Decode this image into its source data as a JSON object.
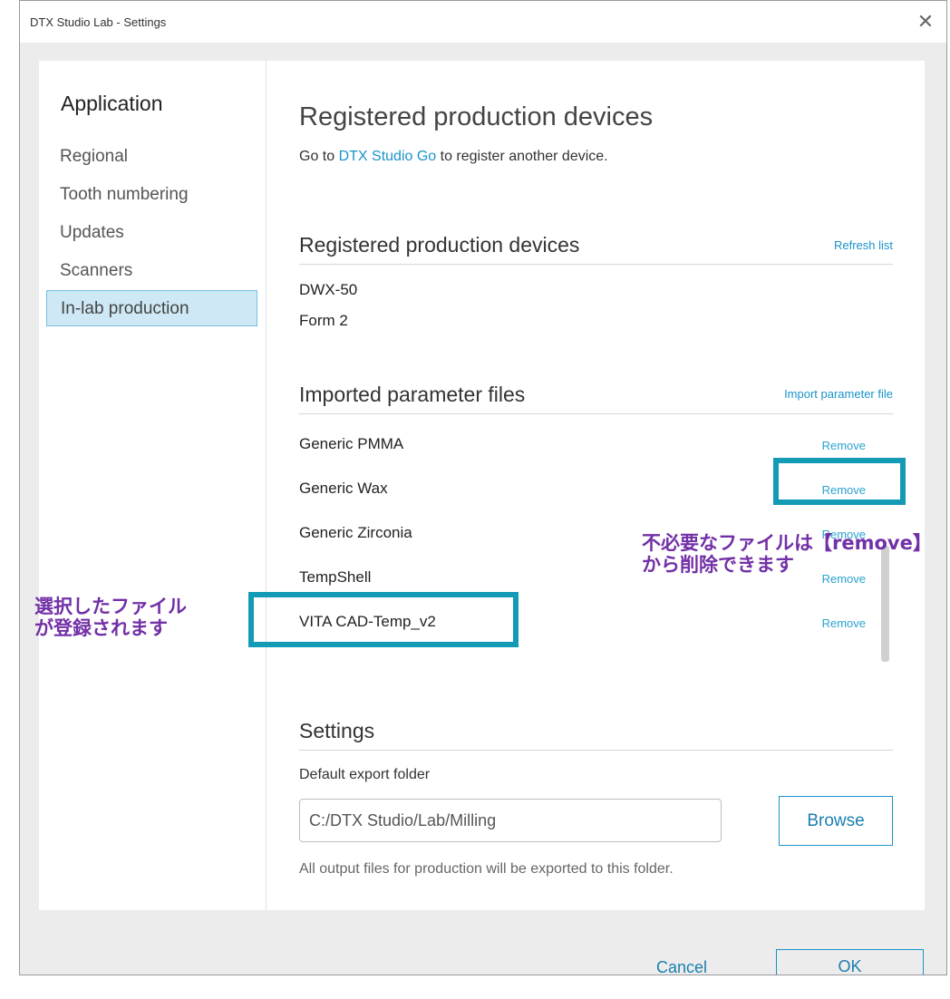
{
  "window": {
    "title": "DTX Studio Lab - Settings"
  },
  "sidebar": {
    "heading": "Application",
    "items": [
      {
        "label": "Regional"
      },
      {
        "label": "Tooth numbering"
      },
      {
        "label": "Updates"
      },
      {
        "label": "Scanners"
      },
      {
        "label": "In-lab production",
        "selected": true
      }
    ]
  },
  "content": {
    "page_title": "Registered production devices",
    "intro": {
      "prefix": "Go to ",
      "link": "DTX Studio Go",
      "suffix": " to register another device."
    },
    "devices_section": {
      "title": "Registered production devices",
      "action": "Refresh list",
      "devices": [
        "DWX-50",
        "Form 2"
      ]
    },
    "params_section": {
      "title": "Imported parameter files",
      "action": "Import parameter file",
      "files": [
        {
          "name": "Generic PMMA",
          "action": "Remove"
        },
        {
          "name": "Generic Wax",
          "action": "Remove"
        },
        {
          "name": "Generic Zirconia",
          "action": "Remove"
        },
        {
          "name": "TempShell",
          "action": "Remove"
        },
        {
          "name": "VITA CAD-Temp_v2",
          "action": "Remove"
        }
      ]
    },
    "settings_section": {
      "title": "Settings",
      "field_label": "Default export folder",
      "folder_value": "C:/DTX Studio/Lab/Milling",
      "browse_label": "Browse",
      "hint": "All output files for production will be exported to this folder."
    }
  },
  "footer": {
    "cancel_label": "Cancel",
    "ok_label": "OK"
  },
  "annotations": {
    "left_note": "選択したファイル\nが登録されます",
    "right_note": "不必要なファイルは【remove】\nから削除できます",
    "color": "#7230a6",
    "box_color": "#139bb5"
  },
  "icons": {
    "close": "close-icon"
  },
  "colors": {
    "accent": "#1a93c9",
    "selected_bg": "#cfe8f5"
  }
}
